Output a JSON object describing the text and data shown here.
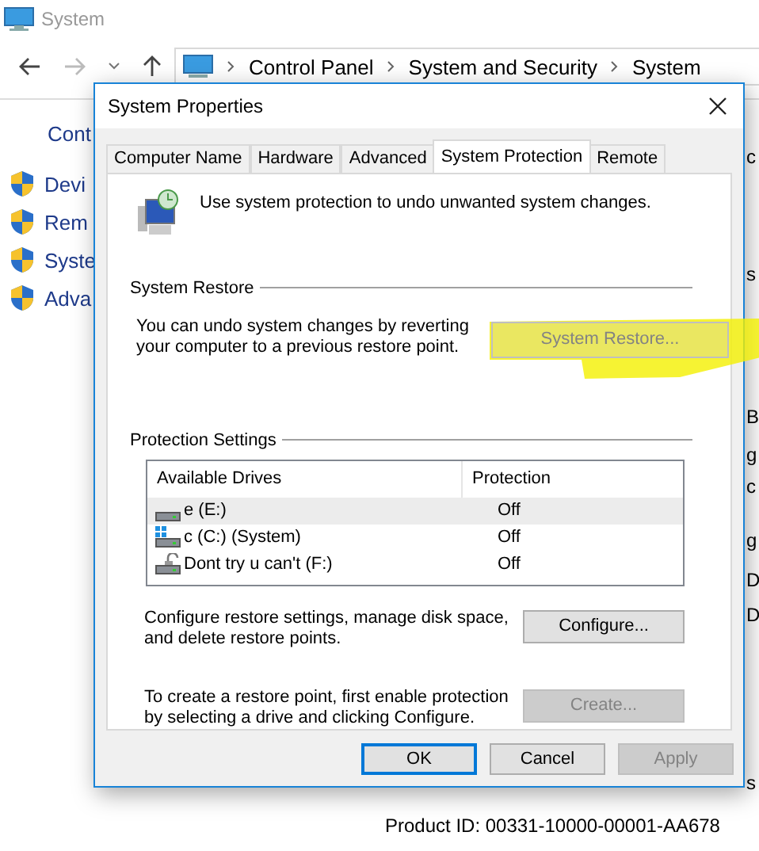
{
  "background_window": {
    "title": "System",
    "breadcrumb": [
      "Control Panel",
      "System and Security",
      "System"
    ],
    "heading": "Cont",
    "links": [
      "Devi",
      "Rem",
      "Syste",
      "Adva"
    ],
    "right_fragments": [
      "c",
      "s",
      "B",
      "g",
      "c",
      "g",
      "D",
      "D",
      "s"
    ],
    "product_id": "Product ID:  00331-10000-00001-AA678"
  },
  "dialog": {
    "title": "System Properties",
    "tabs": [
      {
        "label": "Computer Name",
        "selected": false
      },
      {
        "label": "Hardware",
        "selected": false
      },
      {
        "label": "Advanced",
        "selected": false
      },
      {
        "label": "System Protection",
        "selected": true
      },
      {
        "label": "Remote",
        "selected": false
      }
    ],
    "intro": "Use system protection to undo unwanted system changes.",
    "system_restore": {
      "heading": "System Restore",
      "text": "You can undo system changes by reverting your computer to a previous restore point.",
      "button": {
        "label": "System Restore...",
        "disabled": true,
        "highlighted": true
      }
    },
    "protection": {
      "heading": "Protection Settings",
      "columns": [
        "Available Drives",
        "Protection"
      ],
      "drives": [
        {
          "name": "e (E:)",
          "kind": "drive",
          "protection": "Off",
          "selected": true
        },
        {
          "name": "c (C:) (System)",
          "kind": "system",
          "protection": "Off",
          "selected": false
        },
        {
          "name": "Dont try u can't (F:)",
          "kind": "locked",
          "protection": "Off",
          "selected": false
        }
      ]
    },
    "actions": [
      {
        "text": "Configure restore settings, manage disk space, and delete restore points.",
        "button": {
          "label": "Configure...",
          "disabled": false
        }
      },
      {
        "text": "To create a restore point, first enable protection by selecting a drive and clicking Configure.",
        "button": {
          "label": "Create...",
          "disabled": true
        }
      }
    ],
    "buttons": [
      {
        "label": "OK",
        "default": true,
        "disabled": false
      },
      {
        "label": "Cancel",
        "default": false,
        "disabled": false
      },
      {
        "label": "Apply",
        "default": false,
        "disabled": true
      }
    ]
  }
}
